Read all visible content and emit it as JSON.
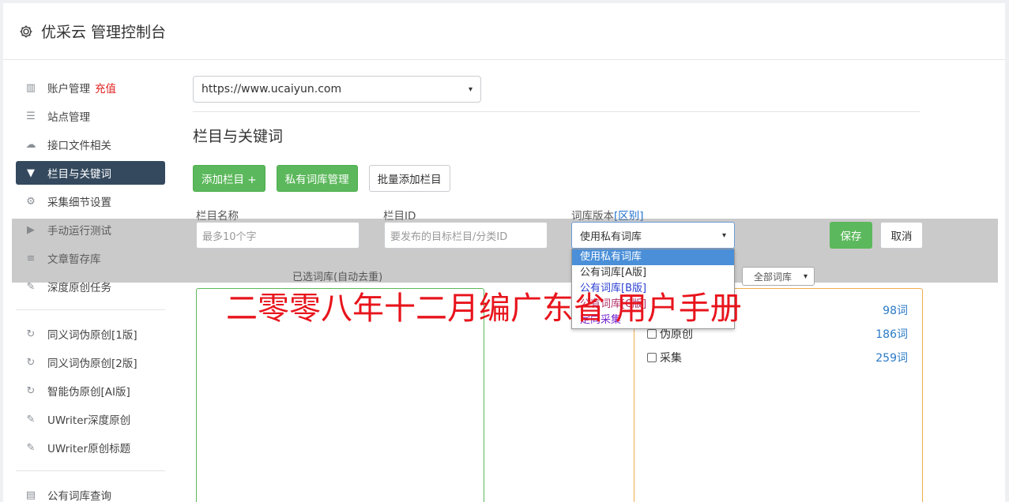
{
  "header": {
    "title": "优采云 管理控制台",
    "icon": "gear-icon"
  },
  "sidebar": {
    "items": [
      {
        "label": "账户管理",
        "icon": "bar-chart-icon",
        "extra": "充值"
      },
      {
        "label": "站点管理",
        "icon": "server-icon"
      },
      {
        "label": "接口文件相关",
        "icon": "cloud-upload-icon"
      },
      {
        "label": "栏目与关键词",
        "icon": "filter-icon",
        "active": true
      },
      {
        "label": "采集细节设置",
        "icon": "cogs-icon"
      },
      {
        "label": "手动运行测试",
        "icon": "play-circle-icon"
      },
      {
        "label": "文章暂存库",
        "icon": "database-icon"
      },
      {
        "label": "深度原创任务",
        "icon": "edit-icon"
      }
    ],
    "items2": [
      {
        "label": "同义词伪原创[1版]",
        "icon": "refresh-icon"
      },
      {
        "label": "同义词伪原创[2版]",
        "icon": "refresh-icon"
      },
      {
        "label": "智能伪原创[AI版]",
        "icon": "refresh-icon"
      },
      {
        "label": "UWriter深度原创",
        "icon": "edit-icon"
      },
      {
        "label": "UWriter原创标题",
        "icon": "edit-icon"
      }
    ],
    "items3": [
      {
        "label": "公有词库查询",
        "icon": "book-icon"
      }
    ]
  },
  "main": {
    "site_select": "https://www.ucaiyun.com",
    "section_title": "栏目与关键词",
    "buttons": {
      "add_column": "添加栏目 +",
      "private_lib": "私有词库管理",
      "batch_add": "批量添加栏目"
    },
    "form": {
      "name_label": "栏目名称",
      "name_placeholder": "最多10个字",
      "id_label": "栏目ID",
      "id_placeholder": "要发布的目标栏目/分类ID",
      "lib_label": "词库版本",
      "lib_label_link": "[区别]",
      "lib_value": "使用私有词库",
      "save": "保存",
      "cancel": "取消"
    },
    "dropdown_options": [
      "使用私有词库",
      "公有词库[A版]",
      "公有词库[B版]",
      "公有词库[C版]",
      "定向采集"
    ],
    "selected_label": "已选词库(自动去重)",
    "all_select": "全部词库",
    "libraries": [
      {
        "label": "",
        "count": "98词"
      },
      {
        "label": "伪原创",
        "count": "186词"
      },
      {
        "label": "采集",
        "count": "259词"
      }
    ]
  },
  "watermark": "二零零八年十二月编广东省 用户手册",
  "colors": {
    "green": "#5cb85c",
    "nav_active": "#34495e",
    "orange": "#f0ad4e",
    "link": "#2a7ac7"
  }
}
